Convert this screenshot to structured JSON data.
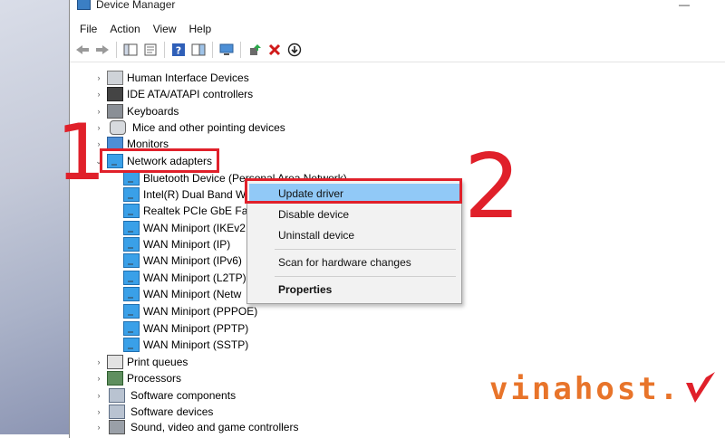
{
  "window": {
    "title": "Device Manager",
    "minimize_glyph": "—"
  },
  "menubar": {
    "items": [
      "File",
      "Action",
      "View",
      "Help"
    ]
  },
  "toolbar": {
    "icons": [
      "back-icon",
      "forward-icon",
      "show-hide-console-tree-icon",
      "properties-icon",
      "help-icon",
      "action-pane-icon",
      "scan-hardware-icon",
      "update-driver-icon",
      "uninstall-icon",
      "download-icon"
    ]
  },
  "tree": {
    "categories_top": [
      {
        "label": "Human Interface Devices",
        "icon": "hid-icon"
      },
      {
        "label": "IDE ATA/ATAPI controllers",
        "icon": "ide-controller-icon"
      },
      {
        "label": "Keyboards",
        "icon": "keyboard-icon"
      },
      {
        "label": "Mice and other pointing devices",
        "icon": "mouse-icon"
      },
      {
        "label": "Monitors",
        "icon": "monitor-icon"
      }
    ],
    "network_adapters": {
      "label": "Network adapters",
      "icon": "network-adapter-icon",
      "expand_glyph": "⌄",
      "children": [
        "Bluetooth Device (Personal Area Network)",
        "Intel(R) Dual Band W",
        "Realtek PCIe GbE Fam",
        "WAN Miniport (IKEv2",
        "WAN Miniport (IP)",
        "WAN Miniport (IPv6)",
        "WAN Miniport (L2TP)",
        "WAN Miniport (Netw",
        "WAN Miniport (PPPOE)",
        "WAN Miniport (PPTP)",
        "WAN Miniport (SSTP)"
      ]
    },
    "categories_bottom": [
      {
        "label": "Print queues",
        "icon": "printer-icon"
      },
      {
        "label": "Processors",
        "icon": "processor-icon"
      },
      {
        "label": "Software components",
        "icon": "software-component-icon"
      },
      {
        "label": "Software devices",
        "icon": "software-device-icon"
      },
      {
        "label": "Sound, video and game controllers",
        "icon": "sound-icon"
      }
    ],
    "collapse_glyph": "›"
  },
  "context_menu": {
    "items": [
      {
        "label": "Update driver",
        "highlighted": true
      },
      {
        "label": "Disable device"
      },
      {
        "label": "Uninstall device"
      },
      {
        "label": "Scan for hardware changes"
      },
      {
        "label": "Properties",
        "bold": true
      }
    ]
  },
  "annotations": {
    "step1": "1",
    "step2": "2",
    "color": "#e0202a"
  },
  "branding": {
    "text": "vinahost.",
    "color": "#e8742a"
  }
}
